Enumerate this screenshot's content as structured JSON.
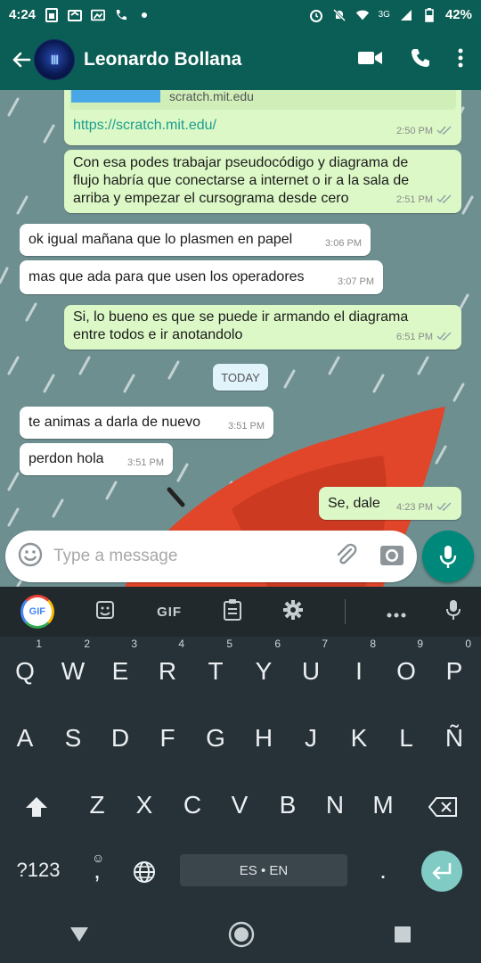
{
  "status_bar": {
    "time": "4:24",
    "network": "3G",
    "battery": "42%"
  },
  "header": {
    "contact_name": "Leonardo Bollana",
    "icons": [
      "back-arrow-icon",
      "video-call-icon",
      "phone-icon",
      "more-vert-icon"
    ]
  },
  "messages": {
    "link_preview_domain": "scratch.mit.edu",
    "link_url": "https://scratch.mit.edu/",
    "m1_time": "2:50 PM",
    "m2_line1": "Con esa podes trabajar pseudocódigo y diagrama de",
    "m2_line2": "flujo habría que conectarse a internet o ir a la sala de",
    "m2_line3": "arriba y empezar el cursograma desde cero",
    "m2_time": "2:51 PM",
    "m3_text": "ok igual mañana que lo plasmen en papel",
    "m3_time": "3:06 PM",
    "m4_text": "mas que ada para que usen los operadores",
    "m4_time": "3:07 PM",
    "m5_line1": "Si, lo bueno es que se puede ir armando el diagrama",
    "m5_line2": "entre todos e ir anotandolo",
    "m5_time": "6:51 PM",
    "day_separator": "TODAY",
    "m6_text": "te animas a darla de nuevo",
    "m6_time": "3:51 PM",
    "m7_text": "perdon hola",
    "m7_time": "3:51 PM",
    "m8_text": "Se, dale",
    "m8_time": "4:23 PM"
  },
  "composer": {
    "placeholder": "Type a message"
  },
  "keyboard": {
    "toolbar_gif_label": "GIF",
    "toolbar_gif_text": "GIF",
    "row1": [
      "Q",
      "W",
      "E",
      "R",
      "T",
      "Y",
      "U",
      "I",
      "O",
      "P"
    ],
    "row1_digits": [
      "1",
      "2",
      "3",
      "4",
      "5",
      "6",
      "7",
      "8",
      "9",
      "0"
    ],
    "row2": [
      "A",
      "S",
      "D",
      "F",
      "G",
      "H",
      "J",
      "K",
      "L",
      "Ñ"
    ],
    "row3": [
      "Z",
      "X",
      "C",
      "V",
      "B",
      "N",
      "M"
    ],
    "symbols_key": "?123",
    "comma_key": ",",
    "space_label": "ES • EN",
    "period_key": "."
  },
  "colors": {
    "header": "#0b5e55",
    "outgoing_bubble": "#dcf8c6",
    "incoming_bubble": "#ffffff",
    "fab": "#00897b",
    "keyboard_bg": "#263238",
    "read_ticks": "#8fa0a6"
  }
}
